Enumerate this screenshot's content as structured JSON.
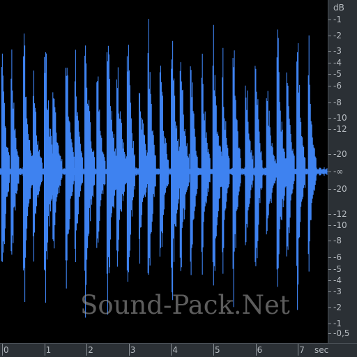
{
  "colors": {
    "waveform": "#3e82f0",
    "background": "#000000",
    "ruler_bg": "#2b3035",
    "ruler_text": "#b7bcc1"
  },
  "watermark": "Sound-Pack.Net",
  "db_ruler": {
    "unit_label": "dB",
    "labels": [
      "-1",
      "-2",
      "-3",
      "-4",
      "-5",
      "-6",
      "-8",
      "-10",
      "-12",
      "-20",
      "-∞",
      "-20",
      "-12",
      "-10",
      "-8",
      "-6",
      "-5",
      "-4",
      "-3",
      "-2",
      "-1",
      "-0,5"
    ]
  },
  "time_ruler": {
    "labels": [
      "0",
      "1",
      "2",
      "3",
      "4",
      "5",
      "6",
      "7"
    ],
    "unit_label": "sec"
  },
  "waveform": {
    "duration_sec": 7.7,
    "transients_per_sec": 4
  }
}
